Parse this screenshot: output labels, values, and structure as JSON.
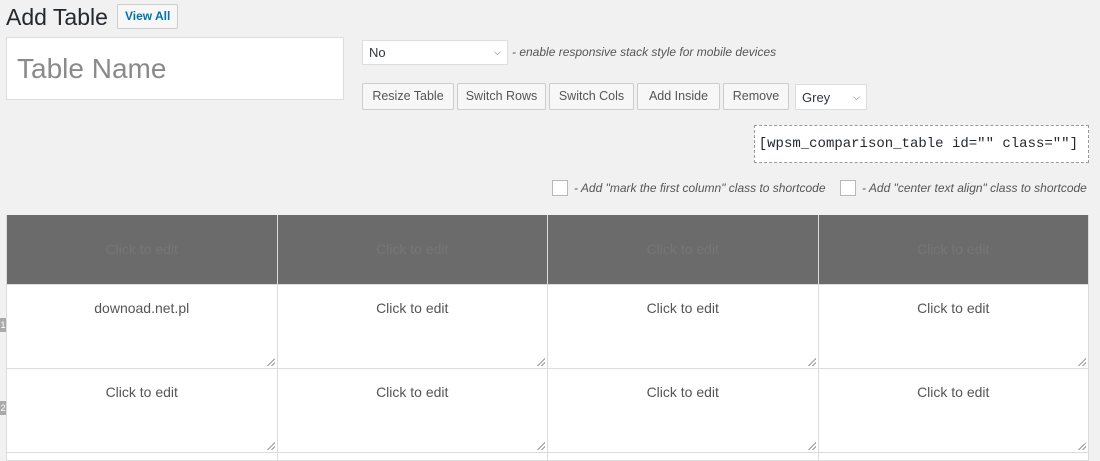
{
  "header": {
    "title": "Add Table",
    "view_all": "View All"
  },
  "form": {
    "table_name_placeholder": "Table Name",
    "responsive_select": "No",
    "responsive_hint": "- enable responsive stack style for mobile devices",
    "color_select": "Grey"
  },
  "toolbar": {
    "resize": "Resize Table",
    "switch_rows": "Switch Rows",
    "switch_cols": "Switch Cols",
    "add_inside": "Add Inside",
    "remove": "Remove"
  },
  "shortcode": "[wpsm_comparison_table id=\"\" class=\"\"]",
  "options": {
    "mark_first_column": "- Add \"mark the first column\" class to shortcode",
    "center_text": "- Add \"center text align\" class to shortcode"
  },
  "table": {
    "headers": [
      "Click to edit",
      "Click to edit",
      "Click to edit",
      "Click to edit"
    ],
    "rows": [
      [
        "downoad.net.pl",
        "Click to edit",
        "Click to edit",
        "Click to edit"
      ],
      [
        "Click to edit",
        "Click to edit",
        "Click to edit",
        "Click to edit"
      ]
    ],
    "row_numbers": [
      "1",
      "2"
    ]
  }
}
